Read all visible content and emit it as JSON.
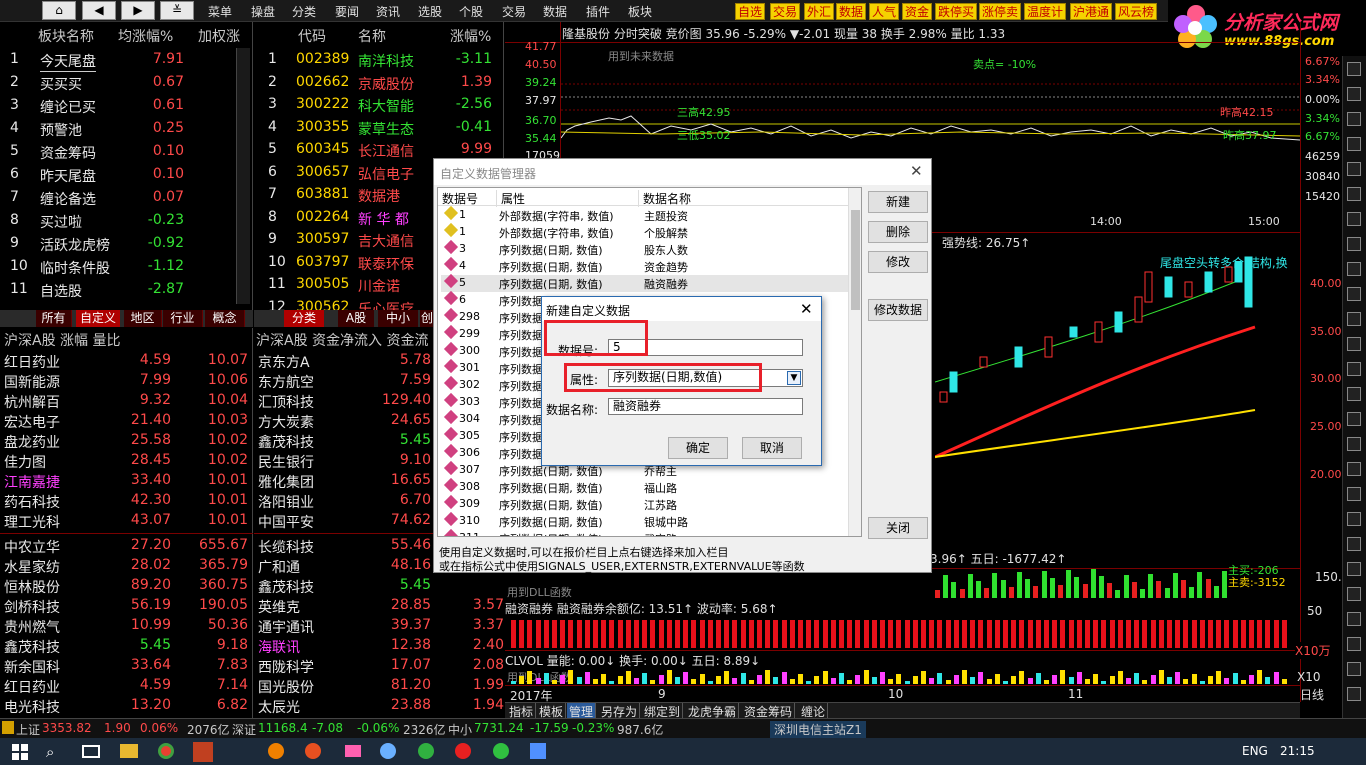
{
  "menu": [
    "菜单",
    "操盘",
    "分类",
    "要闻",
    "资讯",
    "选股",
    "个股",
    "交易",
    "数据",
    "插件",
    "板块"
  ],
  "quick_buttons": [
    "自选",
    "交易",
    "外汇",
    "数据",
    "人气",
    "资金",
    "跌停买",
    "涨停卖",
    "温度计",
    "沪港通",
    "风云榜"
  ],
  "logo": {
    "title": "分析家公式网",
    "url": "www.88gs.com"
  },
  "sector_panel": {
    "headers": {
      "name": "板块名称",
      "change": "均涨幅%",
      "extra": "加权涨"
    },
    "rows": [
      {
        "n": "1",
        "name": "今天尾盘",
        "v": "7.91",
        "c": "red"
      },
      {
        "n": "2",
        "name": "买买买",
        "v": "0.67",
        "c": "red"
      },
      {
        "n": "3",
        "name": "缠论已买",
        "v": "0.61",
        "c": "red"
      },
      {
        "n": "4",
        "name": "预警池",
        "v": "0.25",
        "c": "red"
      },
      {
        "n": "5",
        "name": "资金筹码",
        "v": "0.10",
        "c": "red"
      },
      {
        "n": "6",
        "name": "昨天尾盘",
        "v": "0.10",
        "c": "red"
      },
      {
        "n": "7",
        "name": "缠论备选",
        "v": "0.07",
        "c": "red"
      },
      {
        "n": "8",
        "name": "买过啦",
        "v": "-0.23",
        "c": "green"
      },
      {
        "n": "9",
        "name": "活跃龙虎榜",
        "v": "-0.92",
        "c": "green"
      },
      {
        "n": "10",
        "name": "临时条件股",
        "v": "-1.12",
        "c": "green"
      },
      {
        "n": "11",
        "name": "自选股",
        "v": "-2.87",
        "c": "green"
      }
    ],
    "tabs": [
      "所有",
      "自定义",
      "地区",
      "行业",
      "概念"
    ]
  },
  "stock_panel": {
    "headers": {
      "code": "代码",
      "name": "名称",
      "change": "涨幅%"
    },
    "rows": [
      {
        "n": "1",
        "code": "002389",
        "name": "南洋科技",
        "v": "-3.11",
        "c": "green"
      },
      {
        "n": "2",
        "code": "002662",
        "name": "京威股份",
        "v": "1.39",
        "c": "red"
      },
      {
        "n": "3",
        "code": "300222",
        "name": "科大智能",
        "v": "-2.56",
        "c": "green"
      },
      {
        "n": "4",
        "code": "300355",
        "name": "蒙草生态",
        "v": "-0.41",
        "c": "green"
      },
      {
        "n": "5",
        "code": "600345",
        "name": "长江通信",
        "v": "9.99",
        "c": "red"
      },
      {
        "n": "6",
        "code": "300657",
        "name": "弘信电子",
        "v": "",
        "c": "red"
      },
      {
        "n": "7",
        "code": "603881",
        "name": "数据港",
        "v": "",
        "c": "red"
      },
      {
        "n": "8",
        "code": "002264",
        "name": "新 华 都",
        "v": "",
        "c": "magenta"
      },
      {
        "n": "9",
        "code": "300597",
        "name": "吉大通信",
        "v": "",
        "c": "red"
      },
      {
        "n": "10",
        "code": "603797",
        "name": "联泰环保",
        "v": "",
        "c": "red"
      },
      {
        "n": "11",
        "code": "300505",
        "name": "川金诺",
        "v": "",
        "c": "red"
      },
      {
        "n": "12",
        "code": "300562",
        "name": "乐心医疗",
        "v": "",
        "c": "red"
      }
    ],
    "tabs": [
      "分类",
      "A股",
      "中小",
      "创"
    ]
  },
  "rank_left": {
    "title": "沪深A股 涨幅 量比",
    "top": [
      {
        "name": "红日药业",
        "p": "4.59",
        "v": "10.07"
      },
      {
        "name": "国新能源",
        "p": "7.99",
        "v": "10.06"
      },
      {
        "name": "杭州解百",
        "p": "9.32",
        "v": "10.04"
      },
      {
        "name": "宏达电子",
        "p": "21.40",
        "v": "10.03"
      },
      {
        "name": "盘龙药业",
        "p": "25.58",
        "v": "10.02"
      },
      {
        "name": "佳力图",
        "p": "28.45",
        "v": "10.02"
      },
      {
        "name": "江南嘉捷",
        "p": "33.40",
        "v": "10.01",
        "nc": "magenta"
      },
      {
        "name": "药石科技",
        "p": "42.30",
        "v": "10.01"
      },
      {
        "name": "理工光科",
        "p": "43.07",
        "v": "10.01"
      }
    ],
    "bottom": [
      {
        "name": "中农立华",
        "p": "27.20",
        "v": "655.67"
      },
      {
        "name": "水星家纺",
        "p": "28.02",
        "v": "365.79"
      },
      {
        "name": "恒林股份",
        "p": "89.20",
        "v": "360.75"
      },
      {
        "name": "剑桥科技",
        "p": "56.19",
        "v": "190.05"
      },
      {
        "name": "贵州燃气",
        "p": "10.99",
        "v": "50.36"
      },
      {
        "name": "鑫茂科技",
        "p": "5.45",
        "v": "9.18",
        "pc": "green"
      },
      {
        "name": "新余国科",
        "p": "33.64",
        "v": "7.83"
      },
      {
        "name": "红日药业",
        "p": "4.59",
        "v": "7.14"
      },
      {
        "name": "电光科技",
        "p": "13.20",
        "v": "6.82"
      }
    ]
  },
  "rank_right": {
    "title": "沪深A股 资金净流入 资金流",
    "top": [
      {
        "name": "京东方A",
        "v": "5.78"
      },
      {
        "name": "东方航空",
        "v": "7.59"
      },
      {
        "name": "汇顶科技",
        "v": "129.40"
      },
      {
        "name": "方大炭素",
        "v": "24.65"
      },
      {
        "name": "鑫茂科技",
        "v": "5.45",
        "vc": "green"
      },
      {
        "name": "民生银行",
        "v": "9.10"
      },
      {
        "name": "雅化集团",
        "v": "16.65"
      },
      {
        "name": "洛阳钼业",
        "v": "6.70"
      },
      {
        "name": "中国平安",
        "v": "74.62"
      }
    ],
    "bottom": [
      {
        "name": "长缆科技",
        "v": "55.46",
        "e": ""
      },
      {
        "name": "广和通",
        "v": "48.16",
        "e": ""
      },
      {
        "name": "鑫茂科技",
        "v": "5.45",
        "vc": "green",
        "e": ""
      },
      {
        "name": "英维克",
        "v": "28.85",
        "e": "3.57"
      },
      {
        "name": "通宇通讯",
        "v": "39.37",
        "e": "3.37"
      },
      {
        "name": "海联讯",
        "v": "12.38",
        "nc": "magenta",
        "e": "2.40"
      },
      {
        "name": "西陇科学",
        "v": "17.07",
        "e": "2.08"
      },
      {
        "name": "国光股份",
        "v": "81.20",
        "e": "1.99"
      },
      {
        "name": "太辰光",
        "v": "23.88",
        "e": "1.94"
      }
    ]
  },
  "intraday": {
    "info": "隆基股份  分时突破 竞价图  35.96 -5.29%  ▼-2.01  现量 38  换手 2.98%  量比 1.33",
    "future_label": "用到未来数据",
    "sell_label": "卖点= -10%",
    "y_left": [
      "41.77",
      "40.50",
      "39.24",
      "37.97",
      "36.70",
      "35.44",
      "17059"
    ],
    "y_right": [
      "6.67%",
      "3.34%",
      "0.00%",
      "3.34%",
      "6.67%",
      "46259",
      "30840",
      "15420"
    ],
    "annot_high": "三高42.95",
    "annot_low": "三低35.02",
    "annot_prevhigh": "昨高42.15",
    "annot_prevlow": "昨高37.97",
    "time_ticks": [
      "00",
      "14:00",
      "15:00"
    ]
  },
  "kline": {
    "strong_line": "强势线: 26.75↑",
    "pattern_label": "尾盘空头转多合,结构,换",
    "y_right": [
      "40.00",
      "35.00",
      "30.00",
      "25.00",
      "20.00"
    ],
    "flow_label": "3.96↑  五日: -1677.42↑",
    "dll_label": "用到DLL函数",
    "margin_label": "融资融券  融资融券余额亿: 13.51↑  波动率: 5.68↑",
    "margin_right": [
      "150.0",
      "50",
      "X10万"
    ],
    "vol_label": "CLVOL  量能: 0.00↓  换手: 0.00↓  五日: 8.89↓",
    "dll_label2": "用到DLL函数",
    "vol_right": "X10",
    "x_ticks": [
      "2017年",
      "9",
      "10",
      "11"
    ],
    "right_legend": [
      "主买:-206",
      "主卖:-3152"
    ],
    "period": "日线"
  },
  "bottom_tabs": [
    "指标",
    "模板",
    "管理",
    "另存为",
    "绑定到",
    "龙虎争霸",
    "资金筹码",
    "缠论"
  ],
  "status_bar": {
    "sh_label": "上证",
    "sh_val": "3353.82",
    "sh_chg": "1.90",
    "sh_pct": "0.06%",
    "sh_amt": "2076亿",
    "sz_label": "深证",
    "sz_val": "11168.4",
    "sz_chg": "-7.08",
    "sz_pct": "-0.06%",
    "sz_amt": "2326亿",
    "zx_label": "中小",
    "zx_val": "7731.24",
    "zx_chg": "-17.59",
    "zx_pct": "-0.23%",
    "zx_amt": "987.6亿",
    "server": "深圳电信主站Z1"
  },
  "taskbar": {
    "lang": "ENG",
    "time": "21:15"
  },
  "manager_dialog": {
    "title": "自定义数据管理器",
    "col_num": "数据号",
    "col_attr": "属性",
    "col_name": "数据名称",
    "rows": [
      {
        "n": "1",
        "a": "外部数据(字符串, 数值)",
        "m": "主题投资",
        "i": "y"
      },
      {
        "n": "1",
        "a": "外部数据(字符串, 数值)",
        "m": "个股解禁",
        "i": "y"
      },
      {
        "n": "3",
        "a": "序列数据(日期, 数值)",
        "m": "股东人数",
        "i": "m"
      },
      {
        "n": "4",
        "a": "序列数据(日期, 数值)",
        "m": "资金趋势",
        "i": "m"
      },
      {
        "n": "5",
        "a": "序列数据(日期, 数值)",
        "m": "融资融券",
        "i": "m"
      },
      {
        "n": "6",
        "a": "序列数据",
        "m": "",
        "i": "m"
      },
      {
        "n": "298",
        "a": "序列数据",
        "m": "",
        "i": "m"
      },
      {
        "n": "299",
        "a": "序列数据",
        "m": "",
        "i": "m"
      },
      {
        "n": "300",
        "a": "序列数据",
        "m": "",
        "i": "m"
      },
      {
        "n": "301",
        "a": "序列数据",
        "m": "",
        "i": "m"
      },
      {
        "n": "302",
        "a": "序列数据",
        "m": "",
        "i": "m"
      },
      {
        "n": "303",
        "a": "序列数据",
        "m": "",
        "i": "m"
      },
      {
        "n": "304",
        "a": "序列数据",
        "m": "",
        "i": "m"
      },
      {
        "n": "305",
        "a": "序列数据",
        "m": "",
        "i": "m"
      },
      {
        "n": "306",
        "a": "序列数据",
        "m": "",
        "i": "m"
      },
      {
        "n": "307",
        "a": "序列数据(日期, 数值)",
        "m": "乔帮主",
        "i": "m"
      },
      {
        "n": "308",
        "a": "序列数据(日期, 数值)",
        "m": "福山路",
        "i": "m"
      },
      {
        "n": "309",
        "a": "序列数据(日期, 数值)",
        "m": "江苏路",
        "i": "m"
      },
      {
        "n": "310",
        "a": "序列数据(日期, 数值)",
        "m": "银城中路",
        "i": "m"
      },
      {
        "n": "311",
        "a": "序列数据(日期, 数值)",
        "m": "武定路",
        "i": "m"
      }
    ],
    "buttons": {
      "new": "新建",
      "delete": "删除",
      "modify": "修改",
      "modify_data": "修改数据",
      "close": "关闭"
    },
    "hint1": "使用自定义数据时,可以在报价栏目上点右键选择来加入栏目",
    "hint2": "或在指标公式中使用SIGNALS_USER,EXTERNSTR,EXTERNVALUE等函数"
  },
  "new_dialog": {
    "title": "新建自定义数据",
    "num_label": "数据号:",
    "num_value": "5",
    "attr_label": "属性:",
    "attr_value": "序列数据(日期,数值)",
    "name_label": "数据名称:",
    "name_value": "融资融券",
    "ok": "确定",
    "cancel": "取消"
  }
}
